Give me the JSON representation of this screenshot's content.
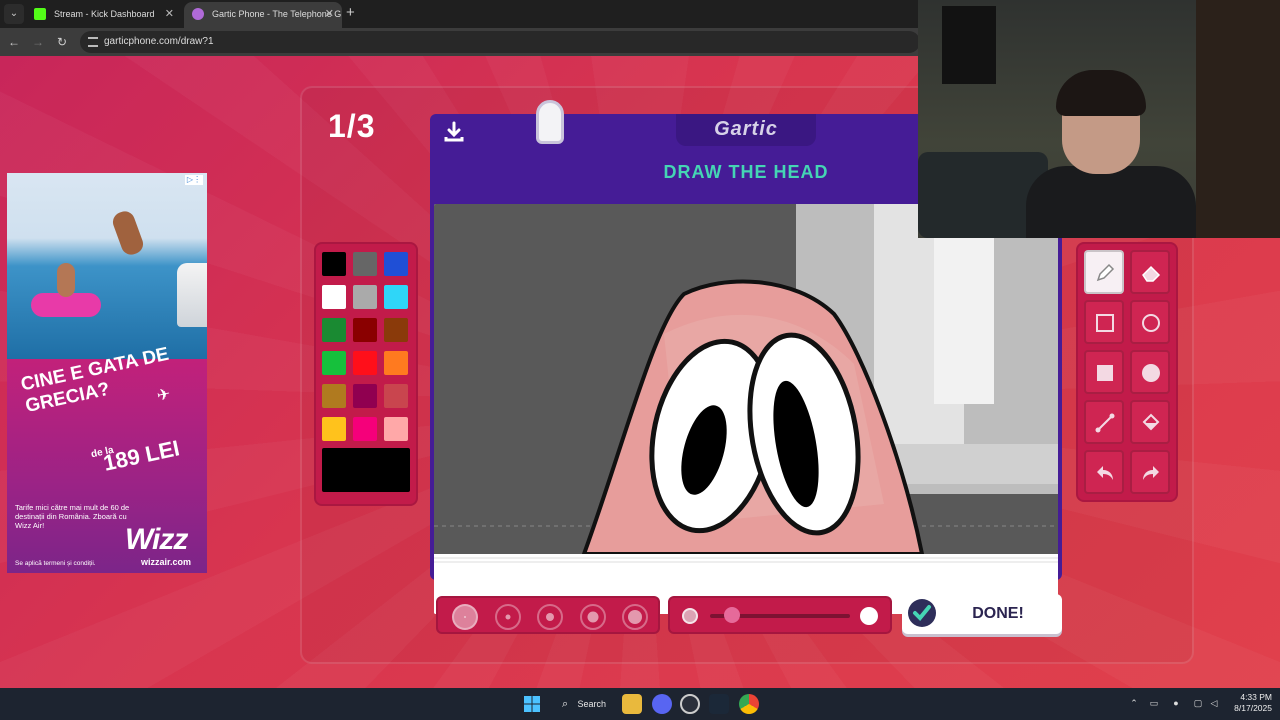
{
  "browser": {
    "tabs": [
      {
        "title": "Stream - Kick Dashboard",
        "active": false,
        "favicon_color": "#53fc18"
      },
      {
        "title": "Gartic Phone - The Telephone G",
        "active": true,
        "favicon_color": "#b06ad8"
      }
    ],
    "url": "garticphone.com/draw?1"
  },
  "game": {
    "round": "1/3",
    "logo": "Gartic",
    "prompt": "DRAW THE HEAD",
    "done_label": "DONE!",
    "palette": [
      "#000000",
      "#666666",
      "#1f4fd6",
      "#ffffff",
      "#aaaaaa",
      "#2fd6f8",
      "#1a8a32",
      "#8a0000",
      "#8a3a0a",
      "#16c03c",
      "#ff0f1a",
      "#ff7a1f",
      "#b07a1f",
      "#900050",
      "#c9454e",
      "#ffc21c",
      "#f5007a",
      "#ffa8a8"
    ],
    "current_color": "#000000",
    "brush_sizes": 5,
    "selected_brush_size": 1,
    "opacity": 0.1
  },
  "tools": [
    "pencil-icon",
    "eraser-icon",
    "rectangle-outline-icon",
    "ellipse-outline-icon",
    "rectangle-filled-icon",
    "ellipse-filled-icon",
    "line-icon",
    "fill-bucket-icon",
    "undo-icon",
    "redo-icon"
  ],
  "ad": {
    "headline": "CINE E GATA DE GRECIA?",
    "price_prefix": "de la",
    "price": "189 LEI",
    "body": "Tarife mici către mai mult de 60 de destinații din România. Zboară cu Wizz Air!",
    "brand": "Wizz",
    "url": "wizzair.com",
    "terms": "Se aplică termeni și condiții."
  },
  "taskbar": {
    "search_label": "Search",
    "time": "4:33 PM",
    "date": "8/17/2025"
  }
}
